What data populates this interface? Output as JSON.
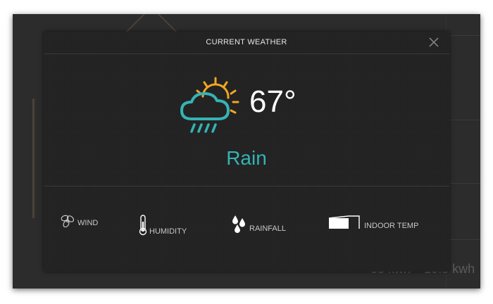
{
  "modal": {
    "title": "CURRENT WEATHER",
    "close_icon": "close-icon"
  },
  "current": {
    "icon": "sun-cloud-rain-icon",
    "temperature": "67°",
    "condition": "Rain"
  },
  "stats": [
    {
      "label": "WIND",
      "icon": "fan-icon"
    },
    {
      "label": "HUMIDITY",
      "icon": "thermometer-icon"
    },
    {
      "label": "RAINFALL",
      "icon": "raindrops-icon"
    },
    {
      "label": "INDOOR TEMP",
      "icon": "indoor-temp-icon"
    }
  ],
  "background": {
    "energy": [
      "33 kwh",
      "10.5 kwh"
    ]
  },
  "colors": {
    "accent": "#35b3b5",
    "sun": "#f0a623",
    "modal_bg": "#222222"
  }
}
